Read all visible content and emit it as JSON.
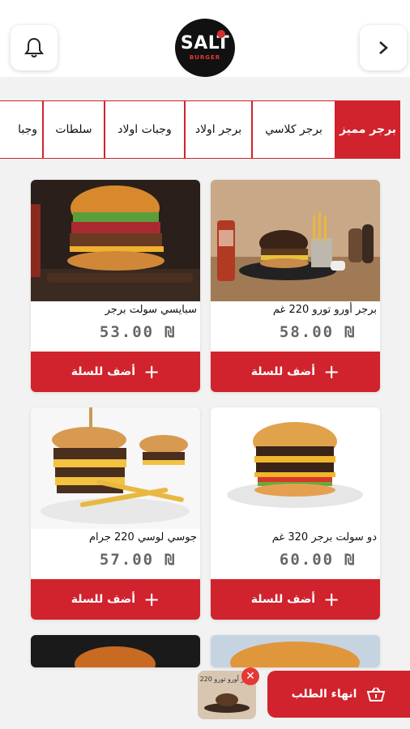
{
  "header": {
    "logo_text": "SALT",
    "logo_sub": "BURGER"
  },
  "tabs": [
    {
      "label": "برجر مميز",
      "active": true
    },
    {
      "label": "برجر كلاسي"
    },
    {
      "label": "برجر اولاد"
    },
    {
      "label": "وجبات اولاد"
    },
    {
      "label": "سلطات"
    },
    {
      "label": "وجبا"
    }
  ],
  "products": [
    {
      "name": "برجر أورو تورو 220 غم",
      "price": "58.00 ₪",
      "button": "أضف للسلة"
    },
    {
      "name": "سبايسي سولت برجر",
      "price": "53.00 ₪",
      "button": "أضف للسلة"
    },
    {
      "name": "دو سولت برجر 320 غم",
      "price": "60.00 ₪",
      "button": "أضف للسلة"
    },
    {
      "name": "جوسي لوسي 220 جرام",
      "price": "57.00 ₪",
      "button": "أضف للسلة"
    }
  ],
  "cart": {
    "finish_label": "انهاء الطلب",
    "thumb_label": "برجر أورو تورو 220",
    "close": "✕"
  },
  "colors": {
    "accent": "#d0232d"
  }
}
